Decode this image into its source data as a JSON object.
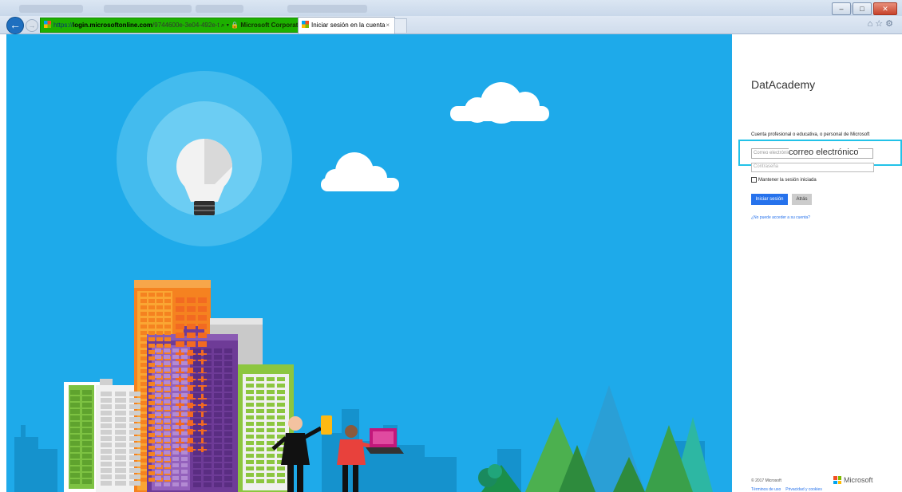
{
  "browser": {
    "url_scheme": "https://",
    "url_host": "login.microsoftonline.com",
    "url_rest": "/9744600e-3e04-492e-t",
    "security_label": "Microsoft Corporation [...",
    "tab_title": "Iniciar sesión en la cuenta",
    "tab_close": "×"
  },
  "signin": {
    "organization": "DatAcademy",
    "account_label": "Cuenta profesional o educativa, o personal de Microsoft",
    "email_placeholder": "Correo electrónico",
    "email_value": "correo electrónico",
    "password_placeholder": "Contraseña",
    "keep_signed_in": "Mantener la sesión iniciada",
    "signin_button": "Iniciar sesión",
    "back_button": "Atrás",
    "cant_access": "¿No puede acceder a su cuenta?"
  },
  "footer": {
    "copyright": "© 2017 Microsoft",
    "terms": "Términos de uso",
    "privacy": "Privacidad y cookies",
    "brand": "Microsoft"
  },
  "colors": {
    "hero_blue": "#1eaaea",
    "signin_blue": "#2672ec",
    "ms_red": "#f25022",
    "ms_green": "#7fba00",
    "ms_blue": "#00a4ef",
    "ms_yellow": "#ffb900"
  }
}
